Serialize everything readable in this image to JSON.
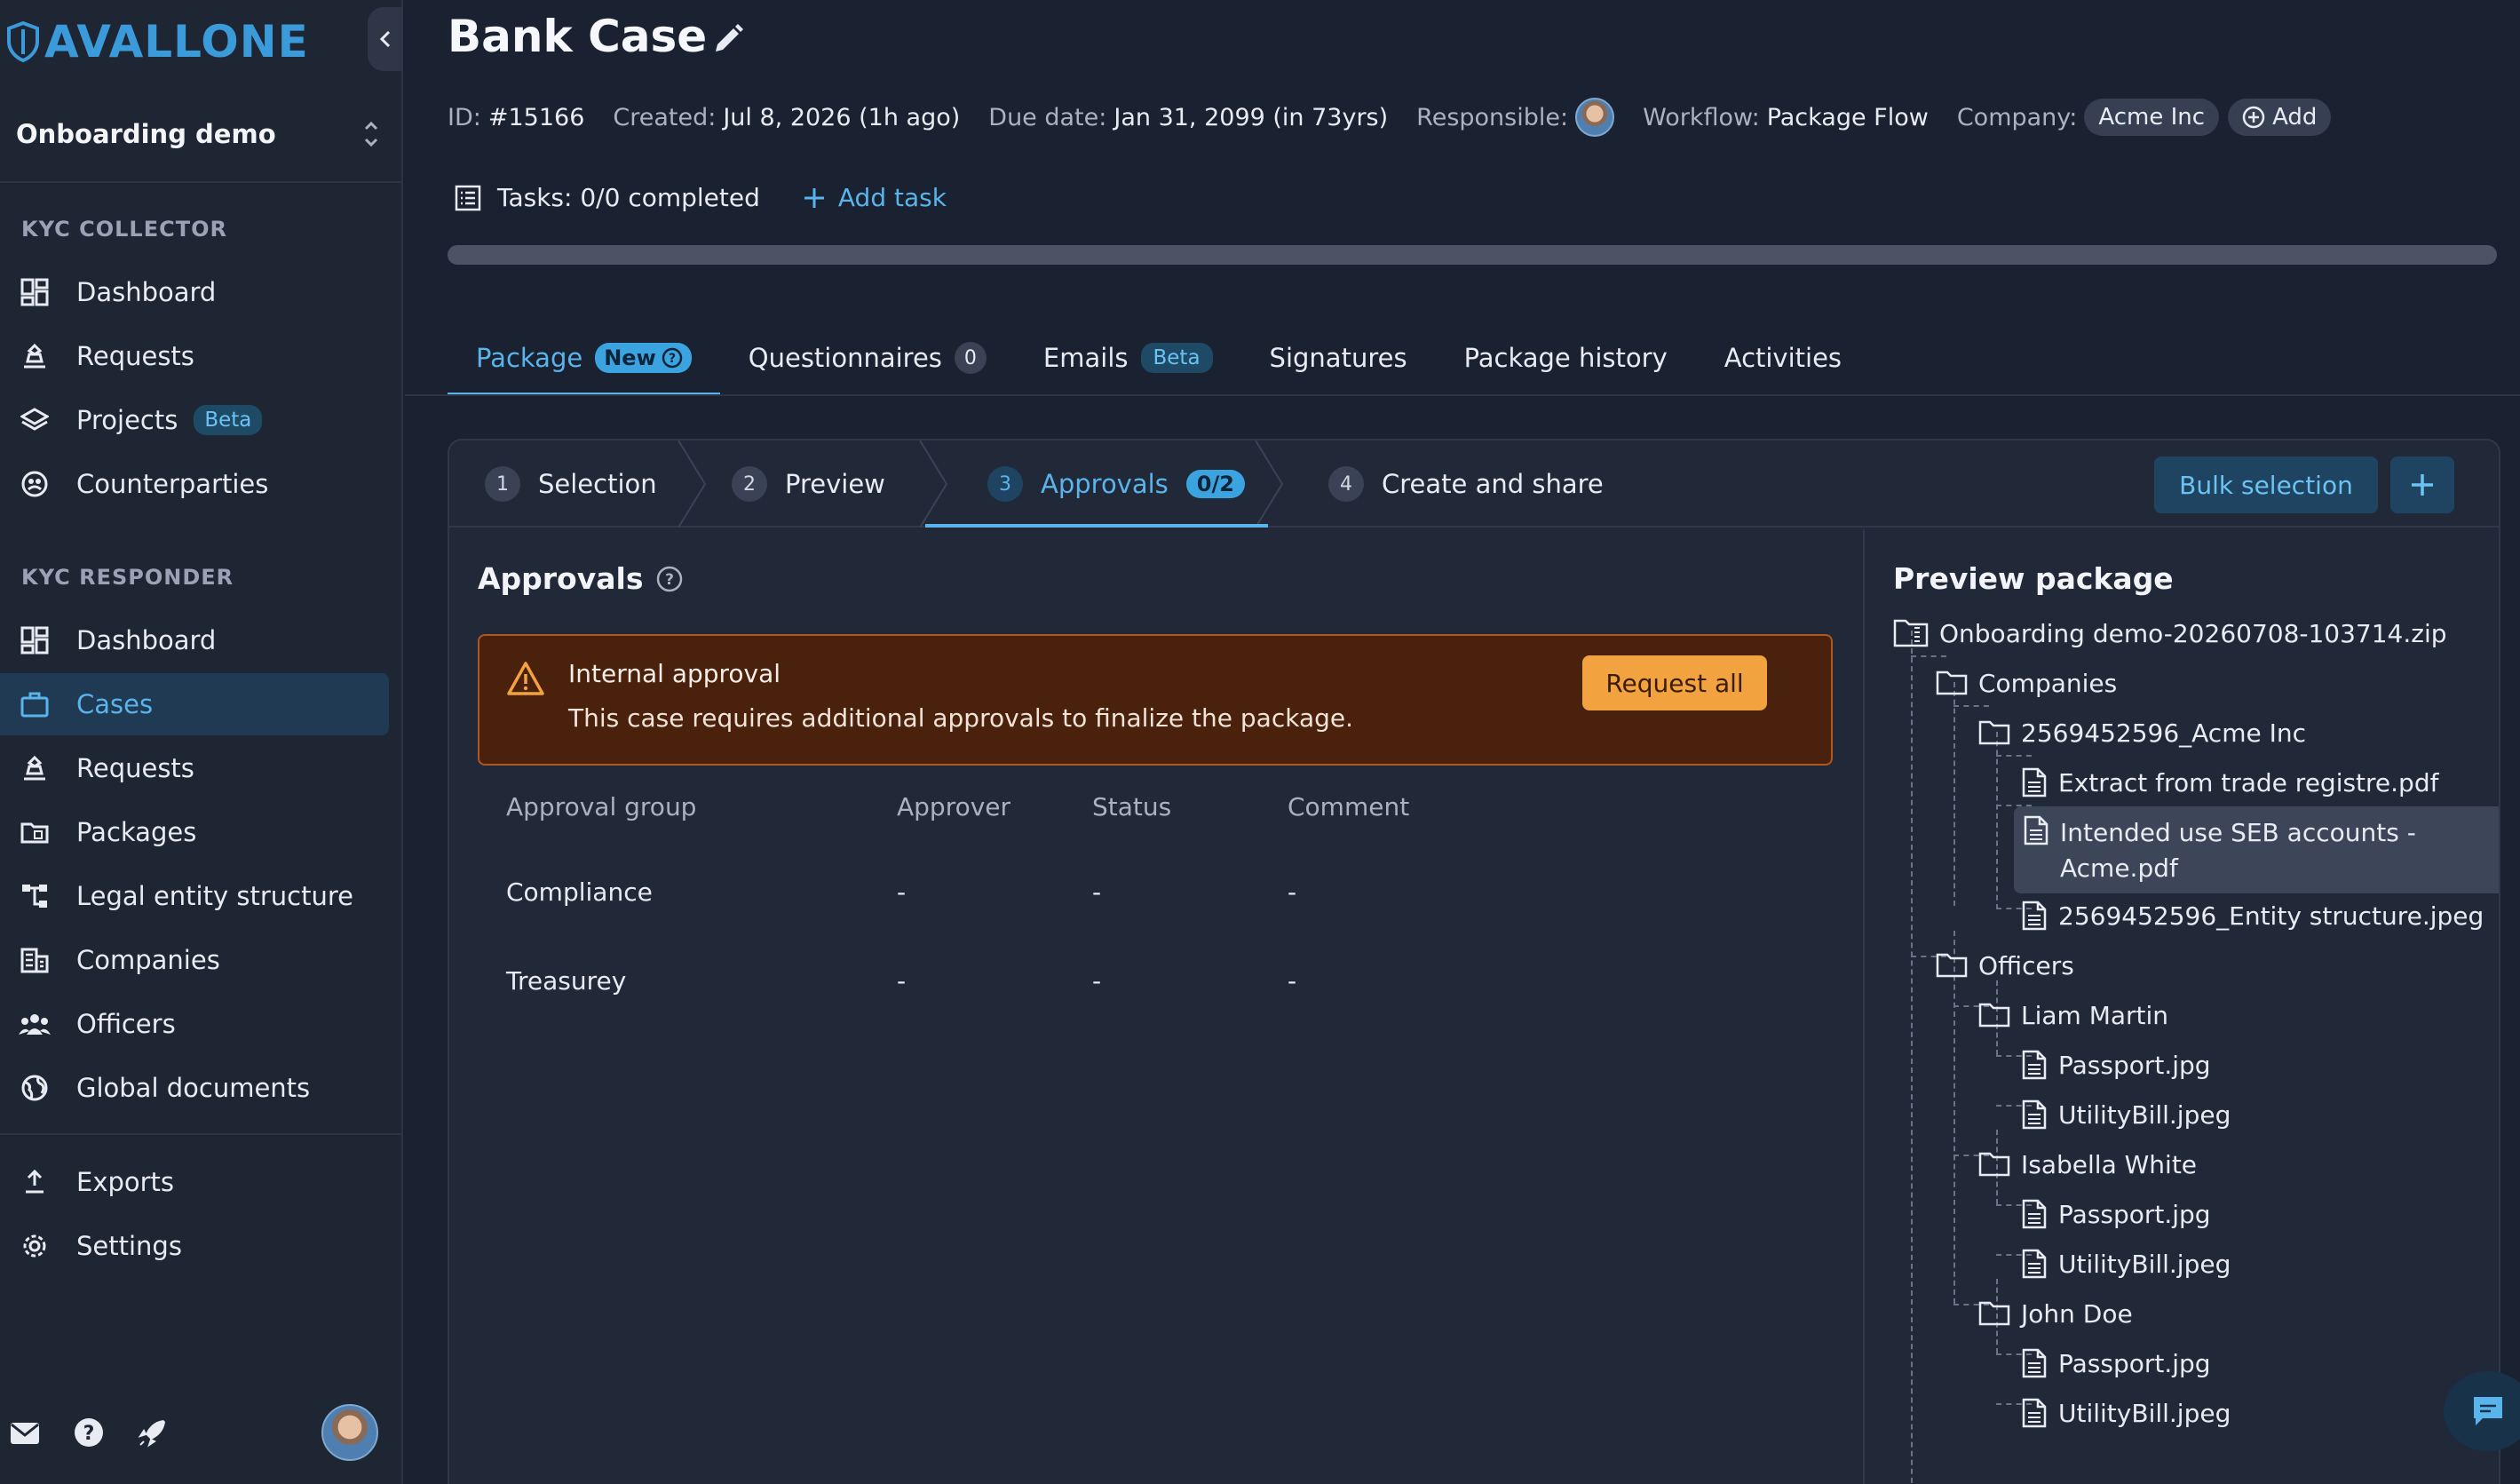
{
  "brand": {
    "logo_text": "AVALLONE",
    "accent": "#3b9ad9"
  },
  "workspace": {
    "name": "Onboarding demo"
  },
  "sidebar": {
    "collector_title": "KYC COLLECTOR",
    "collector_items": [
      {
        "label": "Dashboard",
        "icon": "dashboard-icon"
      },
      {
        "label": "Requests",
        "icon": "requests-icon"
      },
      {
        "label": "Projects",
        "icon": "projects-icon",
        "badge": "Beta"
      },
      {
        "label": "Counterparties",
        "icon": "counterparties-icon"
      }
    ],
    "responder_title": "KYC RESPONDER",
    "responder_items": [
      {
        "label": "Dashboard",
        "icon": "dashboard-icon"
      },
      {
        "label": "Cases",
        "icon": "briefcase-icon",
        "active": true
      },
      {
        "label": "Requests",
        "icon": "requests-icon"
      },
      {
        "label": "Packages",
        "icon": "packages-icon"
      },
      {
        "label": "Legal entity structure",
        "icon": "hierarchy-icon"
      },
      {
        "label": "Companies",
        "icon": "building-icon"
      },
      {
        "label": "Officers",
        "icon": "people-icon"
      },
      {
        "label": "Global documents",
        "icon": "globe-icon"
      }
    ],
    "footer_items": [
      {
        "label": "Exports",
        "icon": "upload-icon"
      },
      {
        "label": "Settings",
        "icon": "gear-icon"
      }
    ]
  },
  "case": {
    "title": "Bank Case",
    "id_label": "ID:",
    "id_value": "#15166",
    "created_label": "Created:",
    "created_value": "Jul 8, 2026 (1h ago)",
    "due_label": "Due date:",
    "due_value": "Jan 31, 2099 (in 73yrs)",
    "responsible_label": "Responsible:",
    "workflow_label": "Workflow:",
    "workflow_value": "Package Flow",
    "company_label": "Company:",
    "company_value": "Acme Inc",
    "add_label": "Add"
  },
  "tasks": {
    "label": "Tasks:",
    "value": "0/0 completed",
    "add_label": "Add task",
    "progress": 0
  },
  "tabs": {
    "package": "Package",
    "package_badge": "New",
    "questionnaires": "Questionnaires",
    "questionnaires_count": "0",
    "emails": "Emails",
    "emails_badge": "Beta",
    "signatures": "Signatures",
    "history": "Package history",
    "activities": "Activities"
  },
  "steps": [
    {
      "num": "1",
      "label": "Selection"
    },
    {
      "num": "2",
      "label": "Preview"
    },
    {
      "num": "3",
      "label": "Approvals",
      "badge": "0/2"
    },
    {
      "num": "4",
      "label": "Create and share"
    }
  ],
  "bulk_label": "Bulk selection",
  "approvals": {
    "title": "Approvals",
    "alert_title": "Internal approval",
    "alert_text": "This case requires additional approvals to finalize the package.",
    "request_all": "Request all",
    "columns": [
      "Approval group",
      "Approver",
      "Status",
      "Comment"
    ],
    "rows": [
      [
        "Compliance",
        "-",
        "-",
        "-"
      ],
      [
        "Treasurey",
        "-",
        "-",
        "-"
      ]
    ]
  },
  "preview": {
    "title": "Preview package",
    "root": "Onboarding demo-20260708-103714.zip",
    "companies": "Companies",
    "company_folder": "2569452596_Acme Inc",
    "company_files": [
      "Extract from trade registre.pdf",
      "Intended use SEB accounts -",
      "Acme.pdf",
      "2569452596_Entity structure.jpeg"
    ],
    "officers": "Officers",
    "officer_1": "Liam Martin",
    "officer_2": "Isabella White",
    "officer_3": "John Doe",
    "passport": "Passport.jpg",
    "utility": "UtilityBill.jpeg"
  }
}
